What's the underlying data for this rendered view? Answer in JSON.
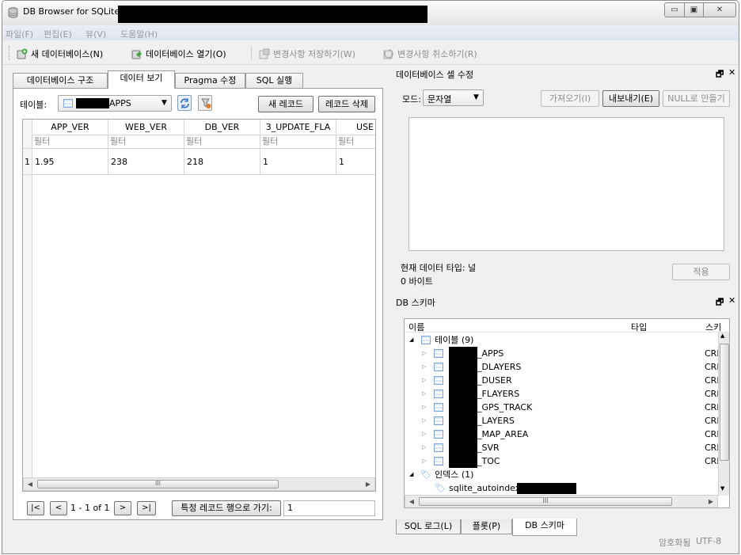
{
  "window": {
    "title": "DB Browser for SQLite -",
    "min_glyph": "▭",
    "max_glyph": "▣",
    "close_glyph": "✕"
  },
  "menu": [
    "파일(F)",
    "편집(E)",
    "뷰(V)",
    "도움말(H)"
  ],
  "toolbar": {
    "new_db": "새 데이터베이스(N)",
    "open_db": "데이터베이스 열기(O)",
    "write_changes": "변경사항 저장하기(W)",
    "revert_changes": "변경사항 취소하기(R)"
  },
  "tabs": [
    "데이터베이스 구조",
    "데이터 보기",
    "Pragma 수정",
    "SQL 실행"
  ],
  "browse": {
    "table_label": "테이블:",
    "table_value": "APPS",
    "new_record": "새 레코드",
    "delete_record": "레코드 삭제",
    "columns": [
      "APP_VER",
      "WEB_VER",
      "DB_VER",
      "3_UPDATE_FLA",
      "USE"
    ],
    "filter_placeholder": "필터",
    "row_number": "1",
    "row": [
      "1.95",
      "238",
      "218",
      "1",
      "1"
    ],
    "scroll_thumb": "III",
    "nav": {
      "first": "|<",
      "prev": "<",
      "range": "1 - 1 of 1",
      "next": ">",
      "last": ">|",
      "goto_button": "특정 레코드 행으로 가기:",
      "goto_value": "1"
    }
  },
  "edit_cell": {
    "title": "데이터베이스 셀 수정",
    "mode_label": "모드:",
    "mode_value": "문자열",
    "import": "가져오기(I)",
    "export": "내보내기(E)",
    "set_null": "NULL로 만들기",
    "type_info": "현재 데이터 타입: 널",
    "size_info": "0 바이트",
    "apply": "적용",
    "float_glyph": "🗗",
    "close_glyph": "✕"
  },
  "schema": {
    "title": "DB 스키마",
    "col_name": "이름",
    "col_type": "타입",
    "col_schema": "스키",
    "tables_group": "테이블 (9)",
    "tables": [
      "_APPS",
      "_DLAYERS",
      "_DUSER",
      "_FLAYERS",
      "_GPS_TRACK",
      "_LAYERS",
      "_MAP_AREA",
      "_SVR",
      "_TOC"
    ],
    "schema_value": "CRI",
    "indices_group": "인덱스 (1)",
    "index_name": "sqlite_autoindex",
    "scroll_thumb": "III"
  },
  "bottom_tabs": [
    "SQL 로그(L)",
    "플롯(P)",
    "DB 스키마"
  ],
  "status": {
    "encryption": "암호화됨",
    "encoding": "UTF-8"
  }
}
